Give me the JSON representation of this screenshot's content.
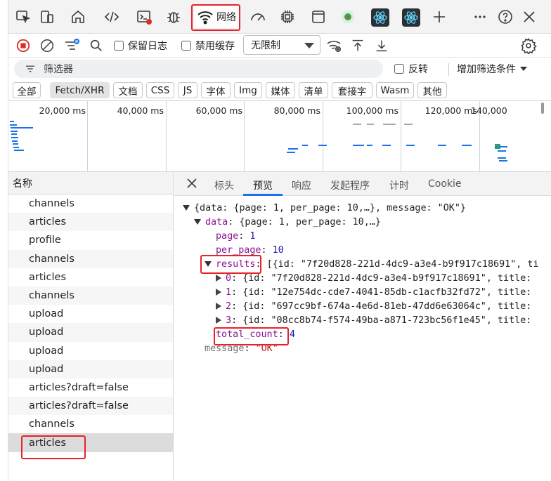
{
  "topbar": {
    "network_tab_label": "网络",
    "icons": [
      "inspect-icon",
      "device-icon",
      "home-icon",
      "code-icon",
      "console-icon",
      "bug-icon",
      "wifi-icon",
      "performance-icon",
      "chip-icon",
      "window-icon",
      "lighthouse-icon",
      "react-components-icon",
      "react-profiler-icon",
      "plus-icon",
      "more-icon",
      "help-icon",
      "close-icon"
    ]
  },
  "toolbar": {
    "preserve_log": "保留日志",
    "disable_cache": "禁用缓存",
    "throttling": "无限制"
  },
  "filter": {
    "placeholder": "筛选器",
    "invert": "反转",
    "more_filters": "增加筛选条件"
  },
  "types": [
    "全部",
    "Fetch/XHR",
    "文档",
    "CSS",
    "JS",
    "字体",
    "Img",
    "媒体",
    "清单",
    "套接字",
    "Wasm",
    "其他"
  ],
  "active_type": "Fetch/XHR",
  "timeline": {
    "ticks": [
      "20,000 ms",
      "40,000 ms",
      "60,000 ms",
      "80,000 ms",
      "100,000 ms",
      "120,000 ms",
      "140,000"
    ]
  },
  "list": {
    "header": "名称",
    "rows": [
      "channels",
      "articles",
      "profile",
      "channels",
      "articles",
      "channels",
      "upload",
      "upload",
      "upload",
      "upload",
      "articles?draft=false",
      "articles?draft=false",
      "channels",
      "articles"
    ],
    "selected_index": 13
  },
  "detail": {
    "tabs": [
      "标头",
      "预览",
      "响应",
      "发起程序",
      "计时",
      "Cookie"
    ],
    "active_tab": "预览",
    "json": {
      "line1": "{data: {page: 1, per_page: 10,…}, message: \"OK\"}",
      "data_key": "data",
      "data_summary": "{page: 1, per_page: 10,…}",
      "page_key": "page",
      "page_val": "1",
      "per_page_key": "per_page",
      "per_page_val": "10",
      "results_key": "results",
      "results_summary": "[{id: \"7f20d828-221d-4dc9-a3e4-b9f917c18691\", ti",
      "items": [
        {
          "idx": "0",
          "text": "{id: \"7f20d828-221d-4dc9-a3e4-b9f917c18691\", title:"
        },
        {
          "idx": "1",
          "text": "{id: \"12e754dc-cde7-4041-85db-c1acfb32fd72\", title:"
        },
        {
          "idx": "2",
          "text": "{id: \"697cc9bf-674a-4e6d-81eb-47dd6e63064c\", title:"
        },
        {
          "idx": "3",
          "text": "{id: \"08cc8b74-f574-49ba-a871-723bc56f1e45\", title:"
        }
      ],
      "total_count_key": "total_count",
      "total_count_val": "4",
      "message_key": "message",
      "message_val": "\"OK\""
    }
  },
  "colors": {
    "accent": "#1a73e8",
    "highlight_box": "#e8222b",
    "json_key": "#881391",
    "json_number": "#1a1aa6",
    "json_string": "#c41a16"
  }
}
